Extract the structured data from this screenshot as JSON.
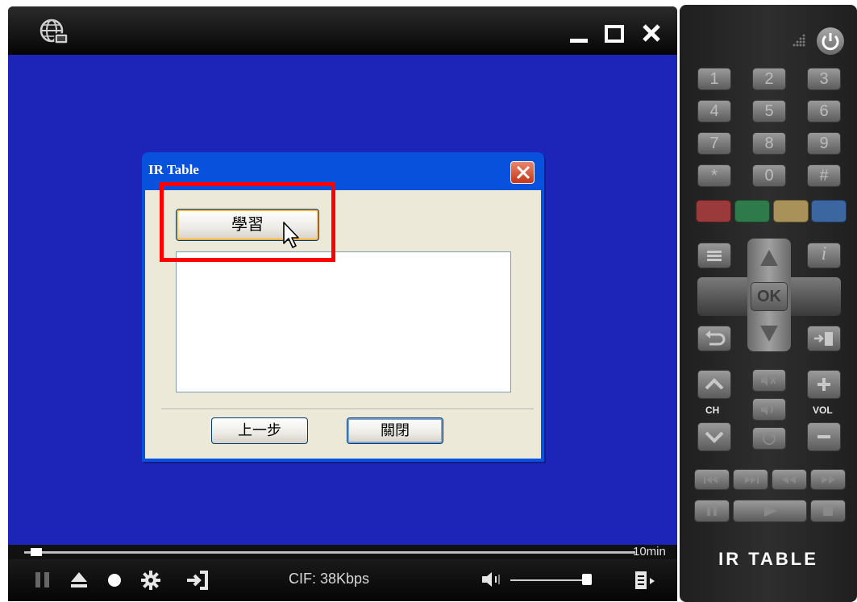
{
  "dialog": {
    "title": "IR Table",
    "learn_button": "學習",
    "back_button": "上一步",
    "close_button": "關閉"
  },
  "progress": {
    "label": "10min",
    "position": 0.01
  },
  "controls": {
    "status": "CIF: 38Kbps",
    "volume": 0.95
  },
  "remote": {
    "keys": [
      "1",
      "2",
      "3",
      "4",
      "5",
      "6",
      "7",
      "8",
      "9",
      "*",
      "0",
      "#"
    ],
    "color_keys": [
      "#9a3a3a",
      "#2f7a4a",
      "#a8925a",
      "#3b66a0"
    ],
    "ok_label": "OK",
    "info_label": "i",
    "ch_label": "CH",
    "vol_label": "VOL",
    "brand": "IR TABLE"
  },
  "colors": {
    "video_bg": "#1c25b8",
    "dialog_title": "#0851dc",
    "highlight": "#ff0000"
  }
}
